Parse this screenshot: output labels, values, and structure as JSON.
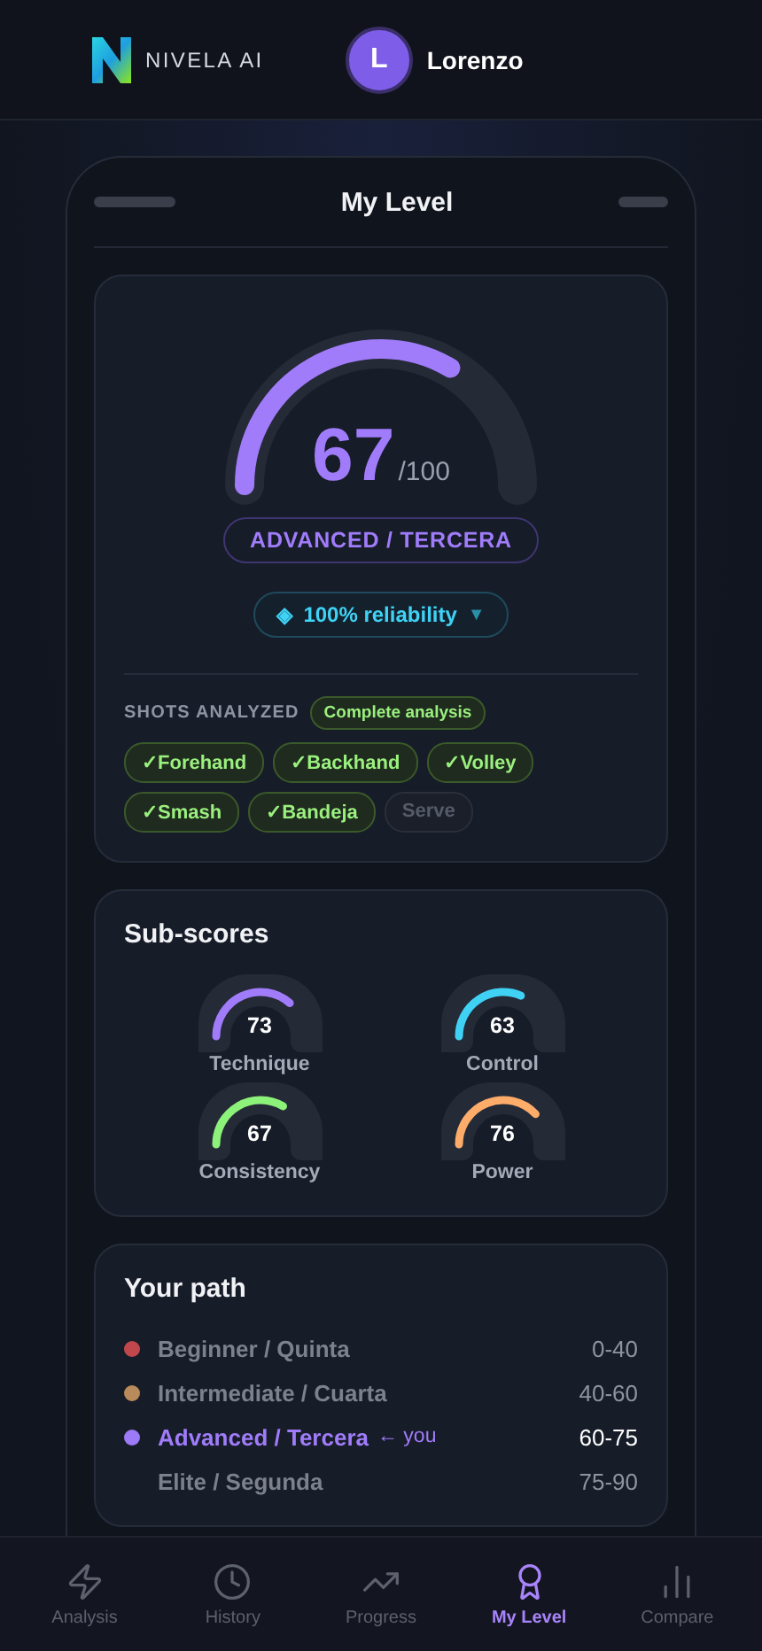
{
  "header": {
    "brand": "NIVELA AI",
    "user": {
      "initial": "L",
      "name": "Lorenzo"
    }
  },
  "screen": {
    "title": "My Level"
  },
  "score": {
    "value": "67",
    "max": "/100",
    "tier": "ADVANCED / TERCERA",
    "reliability": {
      "icon": "◈",
      "label": "100% reliability",
      "caret": "▼"
    }
  },
  "shots": {
    "title": "SHOTS ANALYZED",
    "badge": "Complete analysis",
    "items": [
      {
        "label": "✓Forehand",
        "analyzed": true
      },
      {
        "label": "✓Backhand",
        "analyzed": true
      },
      {
        "label": "✓Volley",
        "analyzed": true
      },
      {
        "label": "✓Smash",
        "analyzed": true
      },
      {
        "label": "✓Bandeja",
        "analyzed": true
      },
      {
        "label": "Serve",
        "analyzed": false
      }
    ]
  },
  "subscores": {
    "title": "Sub-scores",
    "items": [
      {
        "name": "Technique",
        "value": "73",
        "color": "#a07cfa"
      },
      {
        "name": "Control",
        "value": "63",
        "color": "#3fd2f5"
      },
      {
        "name": "Consistency",
        "value": "67",
        "color": "#8cf27a"
      },
      {
        "name": "Power",
        "value": "76",
        "color": "#fdac6a"
      }
    ]
  },
  "path": {
    "title": "Your path",
    "items": [
      {
        "label": "Beginner / Quinta",
        "range": "0-40",
        "color": "#c0474b",
        "selected": false
      },
      {
        "label": "Intermediate / Cuarta",
        "range": "40-60",
        "color": "#b98a5a",
        "selected": false
      },
      {
        "label": "Advanced / Tercera",
        "note": "← you",
        "range": "60-75",
        "color": "#9d7af8",
        "selected": true
      },
      {
        "label": "Elite / Segunda",
        "range": "75-90",
        "selected": false
      }
    ]
  },
  "nav": [
    {
      "label": "Analysis",
      "selected": false
    },
    {
      "label": "History",
      "selected": false
    },
    {
      "label": "Progress",
      "selected": false
    },
    {
      "label": "My Level",
      "selected": true
    },
    {
      "label": "Compare",
      "selected": false
    }
  ]
}
